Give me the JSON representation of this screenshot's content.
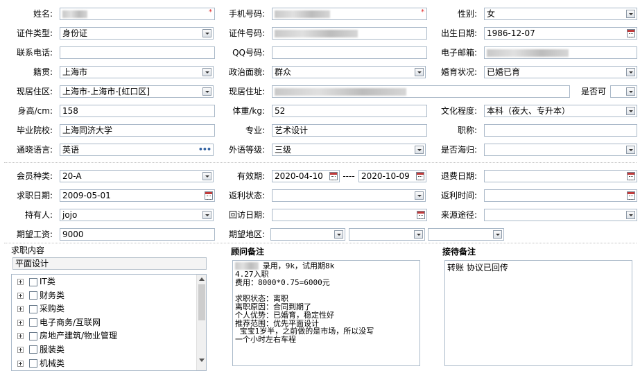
{
  "labels": {
    "name": "姓名:",
    "mobile": "手机号码:",
    "gender": "性别:",
    "id_type": "证件类型:",
    "id_no": "证件号码:",
    "birth": "出生日期:",
    "phone": "联系电话:",
    "qq": "QQ号码:",
    "email": "电子邮箱:",
    "native": "籍贯:",
    "politics": "政治面貌:",
    "marital": "婚育状况:",
    "residence_area": "现居住区:",
    "residence_addr": "现居住址:",
    "can_move": "是否可",
    "height": "身高/cm:",
    "weight": "体重/kg:",
    "education": "文化程度:",
    "school": "毕业院校:",
    "major": "专业:",
    "title": "职称:",
    "language": "通晓语言:",
    "lang_level": "外语等级:",
    "returnee": "是否海归:",
    "member_type": "会员种类:",
    "valid_period": "有效期:",
    "refund_date": "退费日期:",
    "job_date": "求职日期:",
    "rebate_status": "返利状态:",
    "rebate_time": "返利时间:",
    "holder": "持有人:",
    "visit_date": "回访日期:",
    "source": "来源途径:",
    "salary": "期望工资:",
    "area": "期望地区:"
  },
  "values": {
    "gender": "女",
    "id_type": "身份证",
    "birth": "1986-12-07",
    "native": "上海市",
    "politics": "群众",
    "marital": "已婚已育",
    "residence_area": "上海市-上海市-[虹口区]",
    "height": "158",
    "weight": "52",
    "education": "本科（夜大、专升本）",
    "school": "上海同济大学",
    "major": "艺术设计",
    "title": "",
    "language": "英语",
    "lang_level": "三级",
    "returnee": "",
    "member_type": "20-A",
    "valid_from": "2020-04-10",
    "valid_sep": "----",
    "valid_to": "2020-10-09",
    "job_date": "2009-05-01",
    "holder": "jojo",
    "salary": "9000"
  },
  "job_section": {
    "heading": "求职内容",
    "selected": "平面设计",
    "tree": [
      "IT类",
      "财务类",
      "采购类",
      "电子商务/互联网",
      "房地产建筑/物业管理",
      "服装类",
      "机械类"
    ]
  },
  "consultant": {
    "heading": "顾问备注",
    "text": "      录用，9k，试用期8k\n4.27入职\n费用：8000*0.75=6000元\n\n求职状态：离职\n离职原因：合同到期了\n个人优势：已婚育，稳定性好\n推荐范围：优先平面设计\n 宝宝1岁半，之前做的是市场，所以没写\n一个小时左右车程"
  },
  "reception": {
    "heading": "接待备注",
    "text": "转账 协议已回传"
  }
}
